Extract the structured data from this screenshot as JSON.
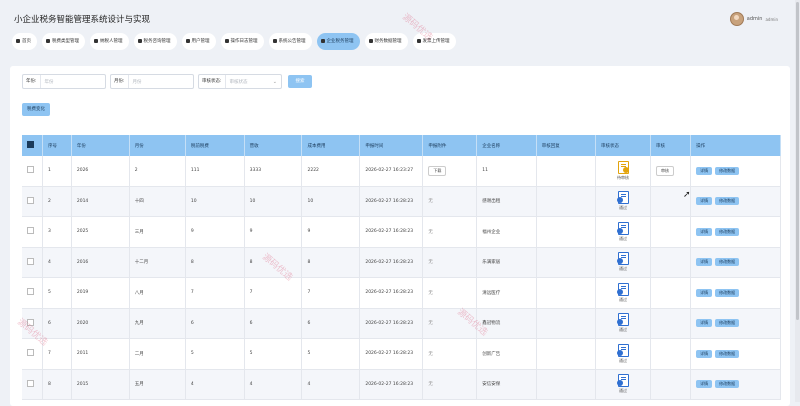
{
  "app": {
    "title": "小企业税务智能管理系统设计与实现"
  },
  "user": {
    "name": "admin",
    "role": "admin"
  },
  "nav": [
    {
      "label": "首页",
      "active": false
    },
    {
      "label": "税费类型管理",
      "active": false
    },
    {
      "label": "纳税人管理",
      "active": false
    },
    {
      "label": "税务咨询管理",
      "active": false
    },
    {
      "label": "用户管理",
      "active": false
    },
    {
      "label": "操作日志管理",
      "active": false
    },
    {
      "label": "系统公告管理",
      "active": false
    },
    {
      "label": "企业税务管理",
      "active": true
    },
    {
      "label": "财务数据管理",
      "active": false
    },
    {
      "label": "发票上传管理",
      "active": false
    }
  ],
  "filters": {
    "year_label": "年份:",
    "year_placeholder": "年份",
    "month_label": "月份:",
    "month_placeholder": "月份",
    "status_label": "审核状态:",
    "status_placeholder": "审核状态",
    "search_label": "搜索"
  },
  "visual_button": "税费变化",
  "table": {
    "headers": [
      "序号",
      "年份",
      "月份",
      "税前税费",
      "营收",
      "成本费用",
      "申报时间",
      "申报附件",
      "企业名称",
      "审核回复",
      "审核状态",
      "审核",
      "操作"
    ],
    "detail_label": "详情",
    "edit_label": "修改数据",
    "audit_label": "审核",
    "rows": [
      {
        "idx": "1",
        "year": "2026",
        "month": "2",
        "tax": "111",
        "revenue": "3333",
        "cost": "2222",
        "time": "2026-02-27 16:23:27",
        "attach": "下载",
        "company": "11",
        "reply": "",
        "status": "待审核",
        "pending": true
      },
      {
        "idx": "2",
        "year": "2014",
        "month": "十四",
        "tax": "10",
        "revenue": "10",
        "cost": "10",
        "time": "2026-02-27 16:28:23",
        "attach": "无",
        "company": "感谢出租",
        "reply": "",
        "status": "通过",
        "pending": false
      },
      {
        "idx": "3",
        "year": "2025",
        "month": "三月",
        "tax": "9",
        "revenue": "9",
        "cost": "9",
        "time": "2026-02-27 16:28:23",
        "attach": "无",
        "company": "福州企业",
        "reply": "",
        "status": "通过",
        "pending": false
      },
      {
        "idx": "4",
        "year": "2016",
        "month": "十二月",
        "tax": "8",
        "revenue": "8",
        "cost": "8",
        "time": "2026-02-27 16:28:23",
        "attach": "无",
        "company": "乐满家居",
        "reply": "",
        "status": "通过",
        "pending": false
      },
      {
        "idx": "5",
        "year": "2019",
        "month": "八月",
        "tax": "7",
        "revenue": "7",
        "cost": "7",
        "time": "2026-02-27 16:28:23",
        "attach": "无",
        "company": "清远医疗",
        "reply": "",
        "status": "通过",
        "pending": false
      },
      {
        "idx": "6",
        "year": "2020",
        "month": "九月",
        "tax": "6",
        "revenue": "6",
        "cost": "6",
        "time": "2026-02-27 16:28:23",
        "attach": "无",
        "company": "鑫冠物流",
        "reply": "",
        "status": "通过",
        "pending": false
      },
      {
        "idx": "7",
        "year": "2011",
        "month": "二月",
        "tax": "5",
        "revenue": "5",
        "cost": "5",
        "time": "2026-02-27 16:28:23",
        "attach": "无",
        "company": "创新广告",
        "reply": "",
        "status": "通过",
        "pending": false
      },
      {
        "idx": "8",
        "year": "2015",
        "month": "五月",
        "tax": "4",
        "revenue": "4",
        "cost": "4",
        "time": "2026-02-27 16:28:23",
        "attach": "无",
        "company": "安信安保",
        "reply": "",
        "status": "通过",
        "pending": false
      }
    ]
  },
  "watermark": "源码优选"
}
